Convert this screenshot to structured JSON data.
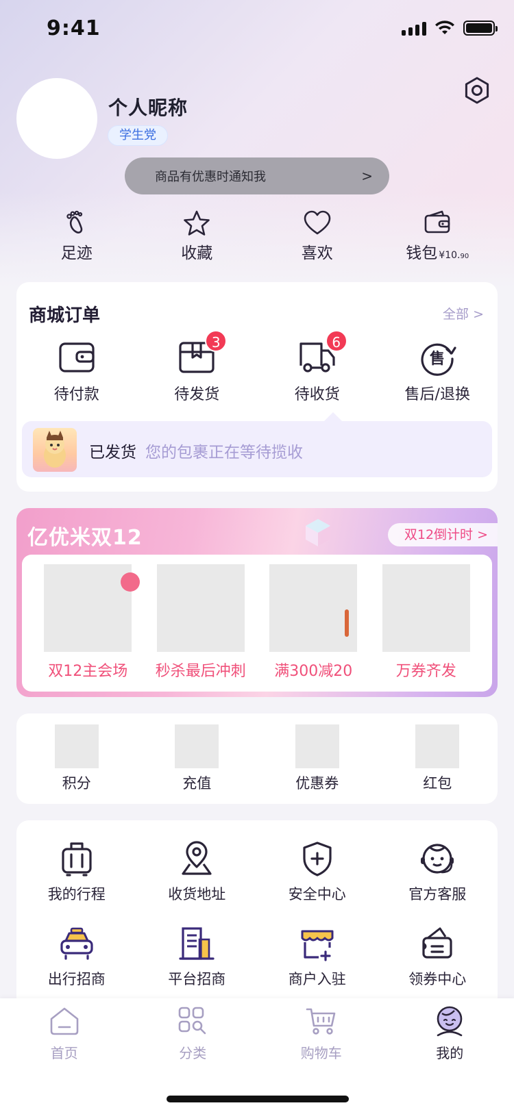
{
  "status_bar": {
    "time": "9:41"
  },
  "profile": {
    "nickname": "个人昵称",
    "tag": "学生党",
    "notify_text": "商品有优惠时通知我",
    "notify_arrow": ">"
  },
  "quick": {
    "items": [
      {
        "label": "足迹",
        "icon": "footprint-icon"
      },
      {
        "label": "收藏",
        "icon": "star-icon"
      },
      {
        "label": "喜欢",
        "icon": "heart-icon"
      },
      {
        "label": "钱包",
        "icon": "wallet-icon"
      }
    ],
    "wallet_currency": "¥",
    "wallet_amount_int": "10.",
    "wallet_amount_dec": "90"
  },
  "orders": {
    "title": "商城订单",
    "all_link": "全部 >",
    "items": [
      {
        "label": "待付款",
        "badge": ""
      },
      {
        "label": "待发货",
        "badge": "3"
      },
      {
        "label": "待收货",
        "badge": "6"
      },
      {
        "label": "售后/退换",
        "badge": ""
      }
    ],
    "shipped_status": "已发货",
    "shipped_desc": "您的包裹正在等待揽收"
  },
  "promo": {
    "title": "亿优米双12",
    "countdown": "双12倒计时 >",
    "items": [
      {
        "label": "双12主会场"
      },
      {
        "label": "秒杀最后冲刺"
      },
      {
        "label": "满300减20"
      },
      {
        "label": "万券齐发"
      }
    ]
  },
  "assets": {
    "items": [
      {
        "label": "积分"
      },
      {
        "label": "充值"
      },
      {
        "label": "优惠券"
      },
      {
        "label": "红包"
      }
    ]
  },
  "services": {
    "items": [
      {
        "label": "我的行程",
        "icon": "luggage-icon"
      },
      {
        "label": "收货地址",
        "icon": "location-icon"
      },
      {
        "label": "安全中心",
        "icon": "shield-icon"
      },
      {
        "label": "官方客服",
        "icon": "customer-service-icon"
      },
      {
        "label": "出行招商",
        "icon": "taxi-icon"
      },
      {
        "label": "平台招商",
        "icon": "building-icon"
      },
      {
        "label": "商户入驻",
        "icon": "store-icon"
      },
      {
        "label": "领券中心",
        "icon": "coupon-icon"
      }
    ]
  },
  "tabbar": {
    "items": [
      {
        "label": "首页",
        "icon": "home-icon"
      },
      {
        "label": "分类",
        "icon": "category-icon"
      },
      {
        "label": "购物车",
        "icon": "cart-icon"
      },
      {
        "label": "我的",
        "icon": "profile-icon"
      }
    ],
    "active": "我的"
  },
  "colors": {
    "accent": "#2a2438",
    "badge": "#f23a55",
    "promo_text": "#f0507a",
    "link": "#a69cc9",
    "shipped_desc": "#a69cd4"
  }
}
